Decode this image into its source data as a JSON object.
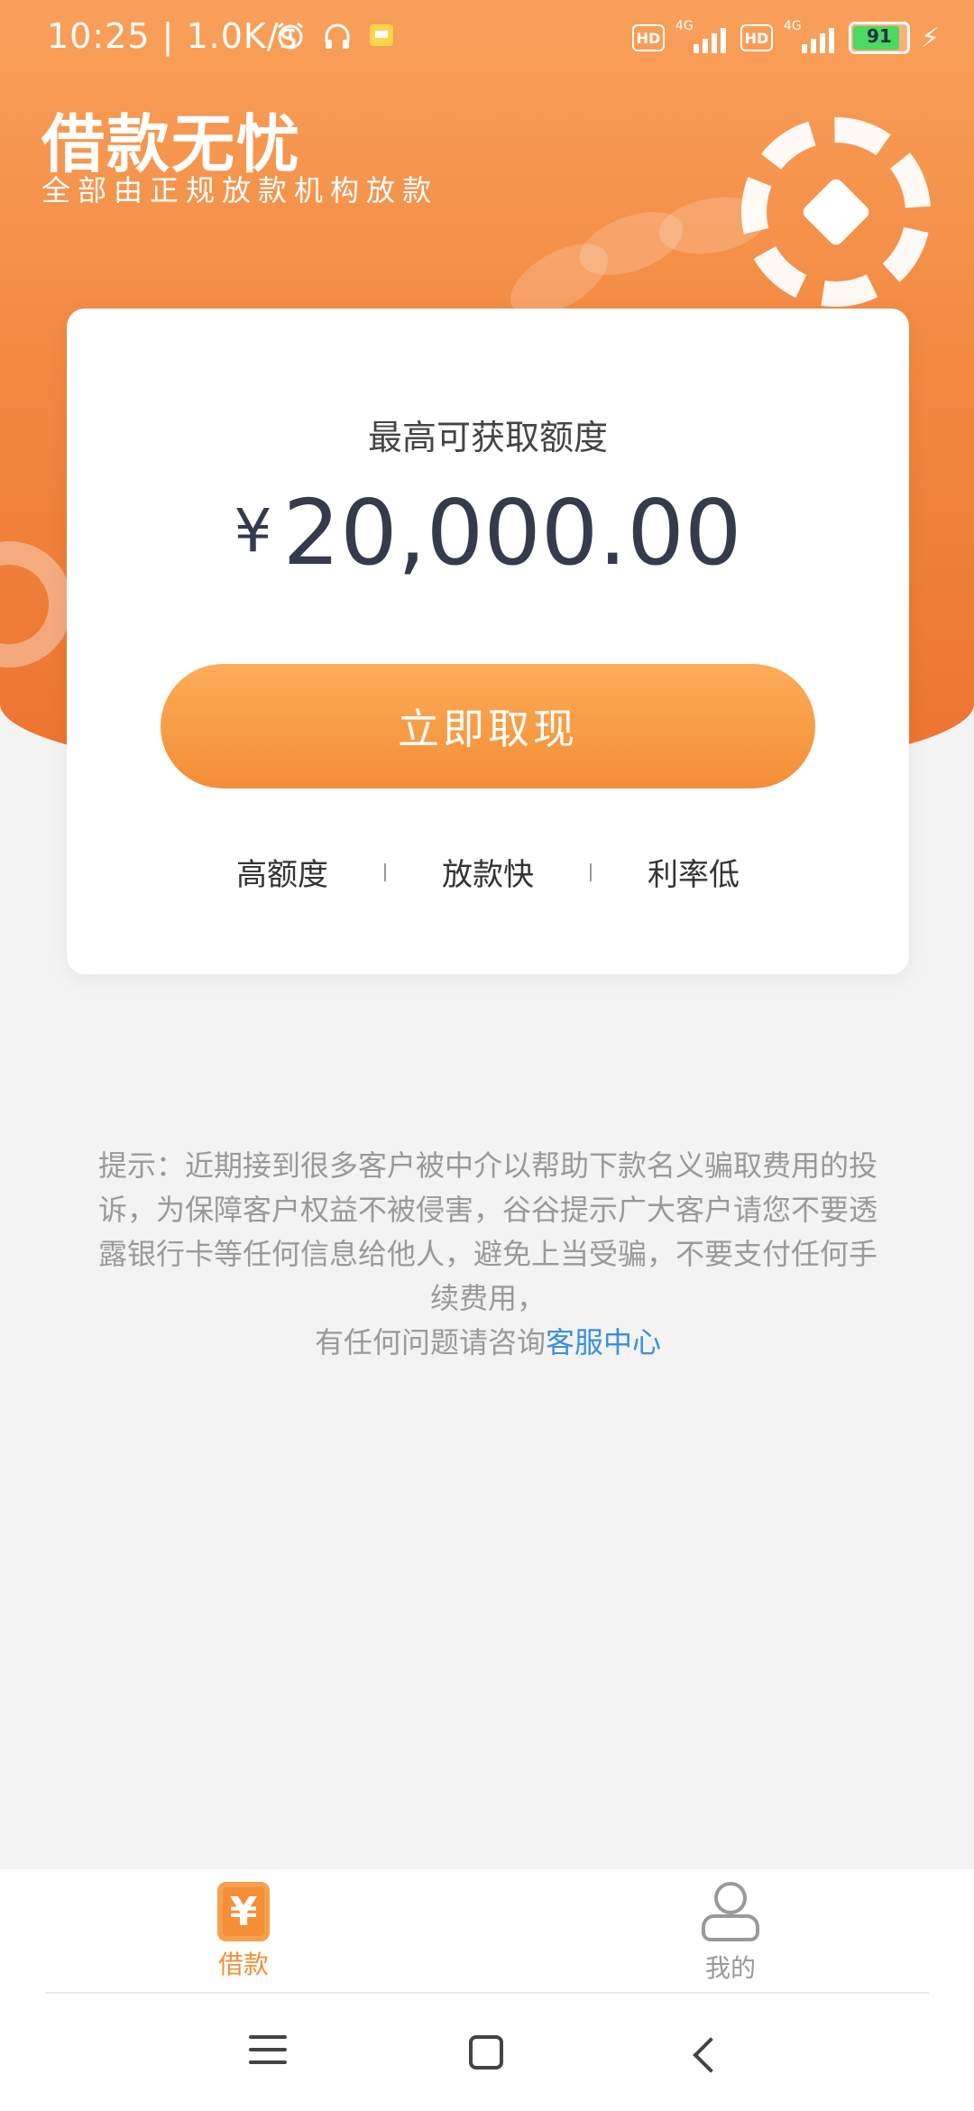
{
  "status_bar": {
    "time": "10:25",
    "speed": "1.0K/s",
    "hd": "HD",
    "network": "4G",
    "battery": "91"
  },
  "header": {
    "title": "借款无忧",
    "subtitle": "全部由正规放款机构放款"
  },
  "card": {
    "label": "最高可获取额度",
    "currency": "¥",
    "amount": "20,000.00",
    "button": "立即取现",
    "features": [
      "高额度",
      "放款快",
      "利率低"
    ]
  },
  "notice": {
    "text": "提示：近期接到很多客户被中介以帮助下款名义骗取费用的投诉，为保障客户权益不被侵害，谷谷提示广大客户请您不要透露银行卡等任何信息给他人，避免上当受骗，不要支付任何手续费用，",
    "help_prefix": "有任何问题请咨询",
    "help_link": "客服中心"
  },
  "tabbar": {
    "tabs": [
      {
        "label": "借款",
        "icon": "yen-icon",
        "active": true,
        "color": "#f48e37"
      },
      {
        "label": "我的",
        "icon": "user-icon",
        "active": false,
        "color": "#999999"
      }
    ]
  },
  "colors": {
    "accent": "#f48e37",
    "link": "#3b8fe0"
  }
}
